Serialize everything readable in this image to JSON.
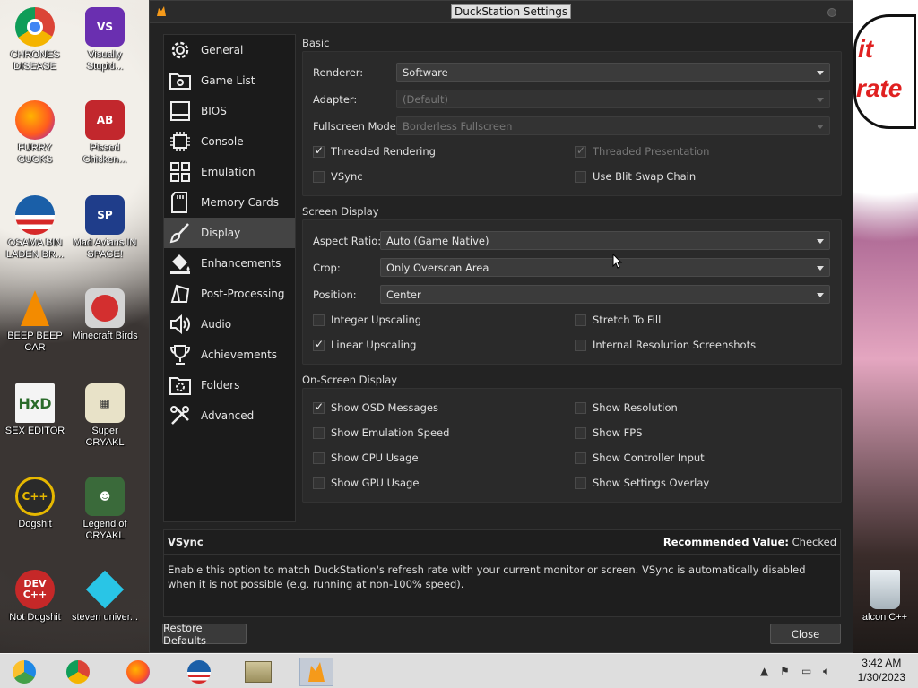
{
  "window": {
    "title": "DuckStation Settings"
  },
  "sidebar": {
    "items": [
      {
        "label": "General",
        "icon": "gear-icon"
      },
      {
        "label": "Game List",
        "icon": "folder-settings-icon"
      },
      {
        "label": "BIOS",
        "icon": "chip-icon"
      },
      {
        "label": "Console",
        "icon": "cpu-icon"
      },
      {
        "label": "Emulation",
        "icon": "grid-icon"
      },
      {
        "label": "Memory Cards",
        "icon": "memory-card-icon"
      },
      {
        "label": "Display",
        "icon": "brush-icon"
      },
      {
        "label": "Enhancements",
        "icon": "paint-bucket-icon"
      },
      {
        "label": "Post-Processing",
        "icon": "shapes-icon"
      },
      {
        "label": "Audio",
        "icon": "speaker-icon"
      },
      {
        "label": "Achievements",
        "icon": "trophy-icon"
      },
      {
        "label": "Folders",
        "icon": "folder-gear-icon"
      },
      {
        "label": "Advanced",
        "icon": "tools-icon"
      }
    ],
    "active": "Display"
  },
  "basic": {
    "title": "Basic",
    "renderer_label": "Renderer:",
    "renderer_value": "Software",
    "adapter_label": "Adapter:",
    "adapter_value": "(Default)",
    "fullscreen_label": "Fullscreen Mode:",
    "fullscreen_value": "Borderless Fullscreen",
    "threaded_rendering": "Threaded Rendering",
    "threaded_presentation": "Threaded Presentation",
    "vsync": "VSync",
    "blit_swap": "Use Blit Swap Chain"
  },
  "screen": {
    "title": "Screen Display",
    "aspect_label": "Aspect Ratio:",
    "aspect_value": "Auto (Game Native)",
    "crop_label": "Crop:",
    "crop_value": "Only Overscan Area",
    "position_label": "Position:",
    "position_value": "Center",
    "integer_upscaling": "Integer Upscaling",
    "stretch_to_fill": "Stretch To Fill",
    "linear_upscaling": "Linear Upscaling",
    "internal_res_screens": "Internal Resolution Screenshots"
  },
  "osd": {
    "title": "On-Screen Display",
    "show_osd": "Show OSD Messages",
    "show_resolution": "Show Resolution",
    "show_emu_speed": "Show Emulation Speed",
    "show_fps": "Show FPS",
    "show_cpu": "Show CPU Usage",
    "show_controller": "Show Controller Input",
    "show_gpu": "Show GPU Usage",
    "show_settings": "Show Settings Overlay"
  },
  "description": {
    "name": "VSync",
    "recommended_label": "Recommended Value:",
    "recommended_value": "Checked",
    "text": "Enable this option to match DuckStation's refresh rate with your current monitor or screen. VSync is automatically disabled when it is not possible (e.g. running at non-100% speed)."
  },
  "buttons": {
    "restore": "Restore Defaults",
    "close": "Close"
  },
  "desktop": {
    "icons": [
      {
        "label": "CHRONES DISEASE"
      },
      {
        "label": "Visually Stupid..."
      },
      {
        "label": "FURRY CUCKS"
      },
      {
        "label": "Pissed Chicken..."
      },
      {
        "label": "OSAMA BIN LADEN BR..."
      },
      {
        "label": "Mad Avians IN SPACE!"
      },
      {
        "label": "BEEP BEEP CAR"
      },
      {
        "label": "Minecraft Birds"
      },
      {
        "label": "SEX EDITOR"
      },
      {
        "label": "Super CRYAKL"
      },
      {
        "label": "Dogshit"
      },
      {
        "label": "Legend of CRYAKL"
      },
      {
        "label": "Not Dogshit"
      },
      {
        "label": "steven univer..."
      },
      {
        "label": "alcon C++"
      }
    ],
    "speech_text_1": "it",
    "speech_text_2": "rate"
  },
  "taskbar": {
    "time": "3:42 AM",
    "date": "1/30/2023"
  },
  "colors": {
    "dialog_bg": "#232323",
    "sidebar_active": "#444444",
    "taskbar": "#dedede"
  }
}
